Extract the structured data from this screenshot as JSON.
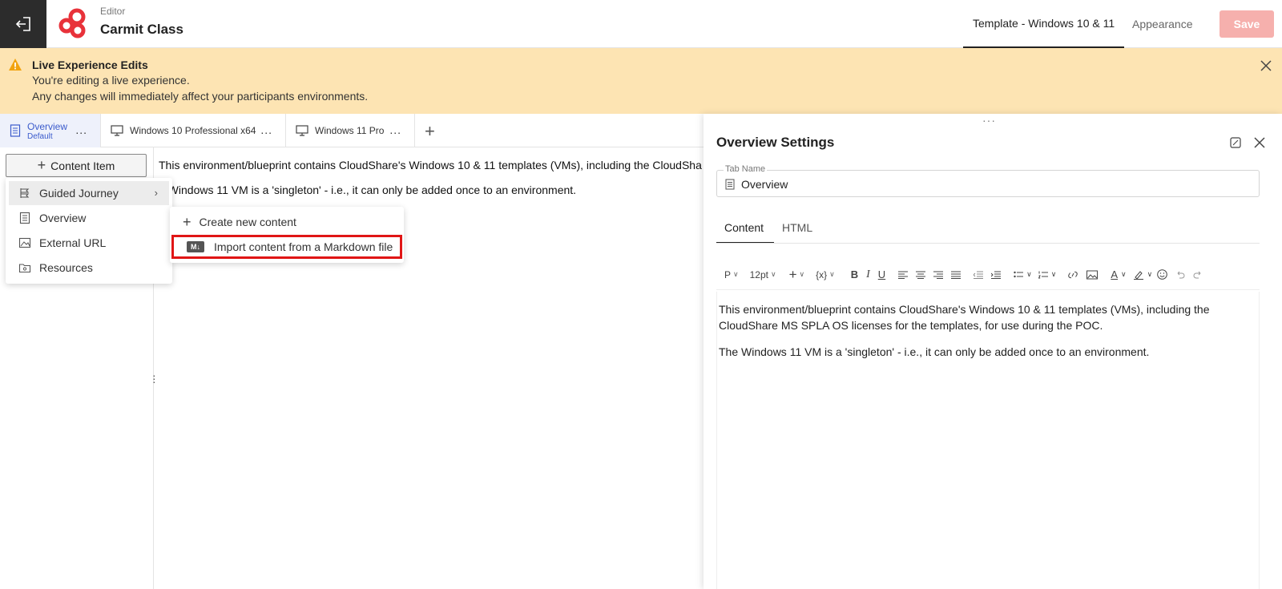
{
  "header": {
    "editor_label": "Editor",
    "title": "Carmit Class",
    "tabs": [
      {
        "label": "Template - Windows 10 & 11",
        "active": true
      },
      {
        "label": "Appearance",
        "active": false
      }
    ],
    "save_label": "Save"
  },
  "alert": {
    "title": "Live Experience Edits",
    "line1": "You're editing a live experience.",
    "line2": "Any changes will immediately affect your participants environments."
  },
  "tab_strip": {
    "tabs": [
      {
        "label": "Overview",
        "sublabel": "Default",
        "icon": "document-icon",
        "active": true
      },
      {
        "label": "Windows 10 Professional x64",
        "icon": "monitor-icon",
        "active": false
      },
      {
        "label": "Windows 11 Pro",
        "icon": "monitor-icon",
        "active": false
      }
    ],
    "more": "...",
    "add": "+"
  },
  "content_item": {
    "button_label": "Content Item",
    "menu": [
      {
        "label": "Guided Journey",
        "icon": "journey-icon",
        "has_submenu": true
      },
      {
        "label": "Overview",
        "icon": "document-icon"
      },
      {
        "label": "External URL",
        "icon": "link-image-icon"
      },
      {
        "label": "Resources",
        "icon": "folder-icon"
      }
    ],
    "submenu": [
      {
        "label": "Create new content",
        "icon": "plus-icon"
      },
      {
        "label": "Import content from a Markdown file",
        "icon": "markdown-icon",
        "badge": "M↓"
      }
    ]
  },
  "preview": {
    "line1": "This environment/blueprint contains CloudShare's Windows 10 & 11 templates (VMs), including the CloudSha",
    "line2": "e Windows 11 VM is a 'singleton' - i.e., it can only be added once to an environment."
  },
  "settings": {
    "title": "Overview Settings",
    "tab_name_label": "Tab Name",
    "tab_name_value": "Overview",
    "subtabs": [
      {
        "label": "Content",
        "active": true
      },
      {
        "label": "HTML",
        "active": false
      }
    ],
    "toolbar": {
      "paragraph": "P",
      "font_size": "12pt",
      "variable": "{x}"
    },
    "editor_paragraphs": [
      "This environment/blueprint contains CloudShare's Windows 10 & 11 templates (VMs), including the CloudShare MS SPLA OS licenses for the templates, for use during the POC.",
      "The Windows 11 VM is a 'singleton' - i.e., it can only be added once to an environment."
    ]
  },
  "colors": {
    "alert_bg": "#fde4b3",
    "save_bg": "#f6b0ad",
    "brand_red": "#e8323a",
    "highlight_border": "#e01515",
    "active_tab_text": "#3b5bcc"
  }
}
